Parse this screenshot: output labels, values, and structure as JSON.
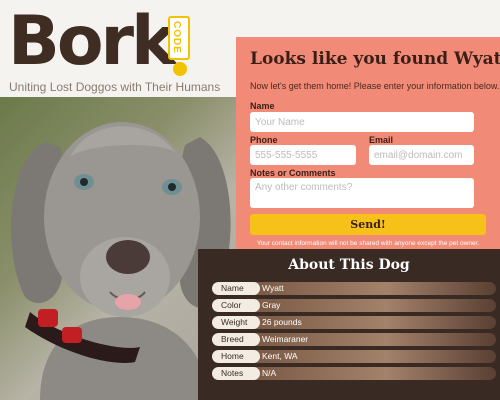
{
  "logo": {
    "wordmark": "Bork",
    "tag": "CODE",
    "tagline": "Uniting Lost Doggos with Their Humans"
  },
  "form": {
    "title": "Looks like you found Wyatt!",
    "intro": "Now let's get them home! Please enter your information below.",
    "name_label": "Name",
    "name_placeholder": "Your Name",
    "phone_label": "Phone",
    "phone_placeholder": "555-555-5555",
    "email_label": "Email",
    "email_placeholder": "email@domain.com",
    "comments_label": "Notes or Comments",
    "comments_placeholder": "Any other comments?",
    "send_label": "Send!",
    "privacy_note": "Your contact information will not be shared with anyone except the pet owner."
  },
  "about": {
    "title": "About This Dog",
    "rows": [
      {
        "key": "Name",
        "value": "Wyatt"
      },
      {
        "key": "Color",
        "value": "Gray"
      },
      {
        "key": "Weight",
        "value": "26 pounds"
      },
      {
        "key": "Breed",
        "value": "Weimaraner"
      },
      {
        "key": "Home",
        "value": "Kent, WA"
      },
      {
        "key": "Notes",
        "value": "N/A"
      }
    ]
  },
  "colors": {
    "brand_dark": "#3f2c22",
    "accent_yellow": "#f6c21a",
    "form_bg": "#f18a76",
    "about_bg": "#3a2a24"
  }
}
